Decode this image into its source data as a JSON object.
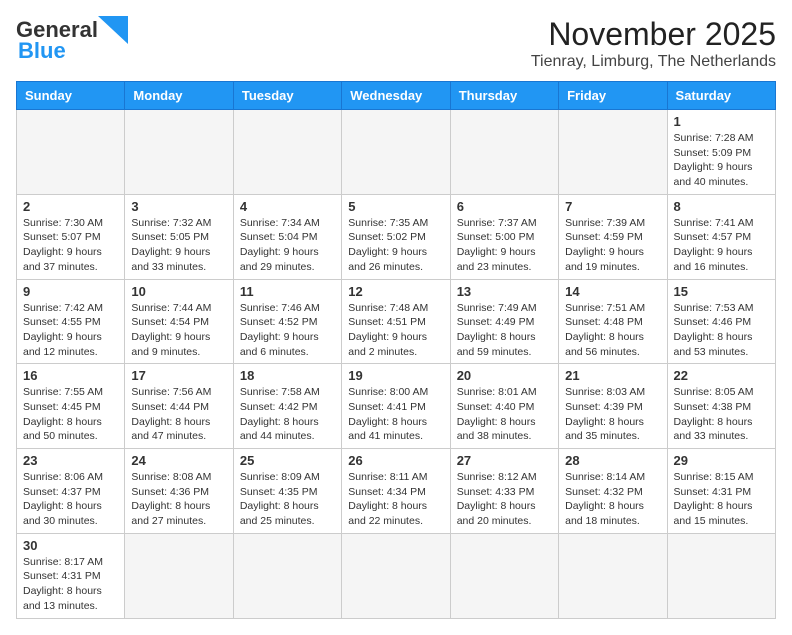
{
  "header": {
    "logo_general": "General",
    "logo_blue": "Blue",
    "month_title": "November 2025",
    "location": "Tienray, Limburg, The Netherlands"
  },
  "weekdays": [
    "Sunday",
    "Monday",
    "Tuesday",
    "Wednesday",
    "Thursday",
    "Friday",
    "Saturday"
  ],
  "weeks": [
    [
      {
        "day": null,
        "info": ""
      },
      {
        "day": null,
        "info": ""
      },
      {
        "day": null,
        "info": ""
      },
      {
        "day": null,
        "info": ""
      },
      {
        "day": null,
        "info": ""
      },
      {
        "day": null,
        "info": ""
      },
      {
        "day": "1",
        "info": "Sunrise: 7:28 AM\nSunset: 5:09 PM\nDaylight: 9 hours and 40 minutes."
      }
    ],
    [
      {
        "day": "2",
        "info": "Sunrise: 7:30 AM\nSunset: 5:07 PM\nDaylight: 9 hours and 37 minutes."
      },
      {
        "day": "3",
        "info": "Sunrise: 7:32 AM\nSunset: 5:05 PM\nDaylight: 9 hours and 33 minutes."
      },
      {
        "day": "4",
        "info": "Sunrise: 7:34 AM\nSunset: 5:04 PM\nDaylight: 9 hours and 29 minutes."
      },
      {
        "day": "5",
        "info": "Sunrise: 7:35 AM\nSunset: 5:02 PM\nDaylight: 9 hours and 26 minutes."
      },
      {
        "day": "6",
        "info": "Sunrise: 7:37 AM\nSunset: 5:00 PM\nDaylight: 9 hours and 23 minutes."
      },
      {
        "day": "7",
        "info": "Sunrise: 7:39 AM\nSunset: 4:59 PM\nDaylight: 9 hours and 19 minutes."
      },
      {
        "day": "8",
        "info": "Sunrise: 7:41 AM\nSunset: 4:57 PM\nDaylight: 9 hours and 16 minutes."
      }
    ],
    [
      {
        "day": "9",
        "info": "Sunrise: 7:42 AM\nSunset: 4:55 PM\nDaylight: 9 hours and 12 minutes."
      },
      {
        "day": "10",
        "info": "Sunrise: 7:44 AM\nSunset: 4:54 PM\nDaylight: 9 hours and 9 minutes."
      },
      {
        "day": "11",
        "info": "Sunrise: 7:46 AM\nSunset: 4:52 PM\nDaylight: 9 hours and 6 minutes."
      },
      {
        "day": "12",
        "info": "Sunrise: 7:48 AM\nSunset: 4:51 PM\nDaylight: 9 hours and 2 minutes."
      },
      {
        "day": "13",
        "info": "Sunrise: 7:49 AM\nSunset: 4:49 PM\nDaylight: 8 hours and 59 minutes."
      },
      {
        "day": "14",
        "info": "Sunrise: 7:51 AM\nSunset: 4:48 PM\nDaylight: 8 hours and 56 minutes."
      },
      {
        "day": "15",
        "info": "Sunrise: 7:53 AM\nSunset: 4:46 PM\nDaylight: 8 hours and 53 minutes."
      }
    ],
    [
      {
        "day": "16",
        "info": "Sunrise: 7:55 AM\nSunset: 4:45 PM\nDaylight: 8 hours and 50 minutes."
      },
      {
        "day": "17",
        "info": "Sunrise: 7:56 AM\nSunset: 4:44 PM\nDaylight: 8 hours and 47 minutes."
      },
      {
        "day": "18",
        "info": "Sunrise: 7:58 AM\nSunset: 4:42 PM\nDaylight: 8 hours and 44 minutes."
      },
      {
        "day": "19",
        "info": "Sunrise: 8:00 AM\nSunset: 4:41 PM\nDaylight: 8 hours and 41 minutes."
      },
      {
        "day": "20",
        "info": "Sunrise: 8:01 AM\nSunset: 4:40 PM\nDaylight: 8 hours and 38 minutes."
      },
      {
        "day": "21",
        "info": "Sunrise: 8:03 AM\nSunset: 4:39 PM\nDaylight: 8 hours and 35 minutes."
      },
      {
        "day": "22",
        "info": "Sunrise: 8:05 AM\nSunset: 4:38 PM\nDaylight: 8 hours and 33 minutes."
      }
    ],
    [
      {
        "day": "23",
        "info": "Sunrise: 8:06 AM\nSunset: 4:37 PM\nDaylight: 8 hours and 30 minutes."
      },
      {
        "day": "24",
        "info": "Sunrise: 8:08 AM\nSunset: 4:36 PM\nDaylight: 8 hours and 27 minutes."
      },
      {
        "day": "25",
        "info": "Sunrise: 8:09 AM\nSunset: 4:35 PM\nDaylight: 8 hours and 25 minutes."
      },
      {
        "day": "26",
        "info": "Sunrise: 8:11 AM\nSunset: 4:34 PM\nDaylight: 8 hours and 22 minutes."
      },
      {
        "day": "27",
        "info": "Sunrise: 8:12 AM\nSunset: 4:33 PM\nDaylight: 8 hours and 20 minutes."
      },
      {
        "day": "28",
        "info": "Sunrise: 8:14 AM\nSunset: 4:32 PM\nDaylight: 8 hours and 18 minutes."
      },
      {
        "day": "29",
        "info": "Sunrise: 8:15 AM\nSunset: 4:31 PM\nDaylight: 8 hours and 15 minutes."
      }
    ],
    [
      {
        "day": "30",
        "info": "Sunrise: 8:17 AM\nSunset: 4:31 PM\nDaylight: 8 hours and 13 minutes."
      },
      {
        "day": null,
        "info": ""
      },
      {
        "day": null,
        "info": ""
      },
      {
        "day": null,
        "info": ""
      },
      {
        "day": null,
        "info": ""
      },
      {
        "day": null,
        "info": ""
      },
      {
        "day": null,
        "info": ""
      }
    ]
  ]
}
